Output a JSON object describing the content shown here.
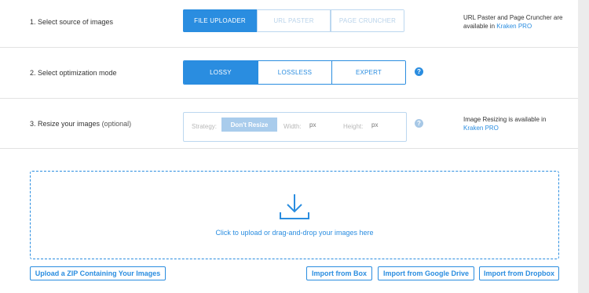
{
  "source": {
    "label": "1. Select source of images",
    "options": [
      "FILE UPLOADER",
      "URL PASTER",
      "PAGE CRUNCHER"
    ],
    "selected": "FILE UPLOADER",
    "note_text": "URL Paster and Page Cruncher are available in",
    "note_link": "Kraken PRO"
  },
  "optimization": {
    "label": "2. Select optimization mode",
    "options": [
      "LOSSY",
      "LOSSLESS",
      "EXPERT"
    ],
    "selected": "LOSSY",
    "help": "?"
  },
  "resize": {
    "label": "3. Resize your images",
    "label_suffix": "(optional)",
    "strategy_label": "Strategy:",
    "strategy_value": "Don't Resize",
    "width_label": "Width:",
    "width_placeholder": "px",
    "height_label": "Height:",
    "height_placeholder": "px",
    "help": "?",
    "note_text": "Image Resizing is available in",
    "note_link": "Kraken PRO"
  },
  "dropzone": {
    "icon": "download-arrow-icon",
    "text": "Click to upload or drag-and-drop your images here"
  },
  "actions": {
    "zip": "Upload a ZIP Containing Your Images",
    "box": "Import from Box",
    "gdrive": "Import from Google Drive",
    "dropbox": "Import from Dropbox"
  },
  "colors": {
    "accent": "#2a8de0",
    "accent_disabled": "#a9ccec",
    "background": "#ececec",
    "panel": "#ffffff"
  }
}
